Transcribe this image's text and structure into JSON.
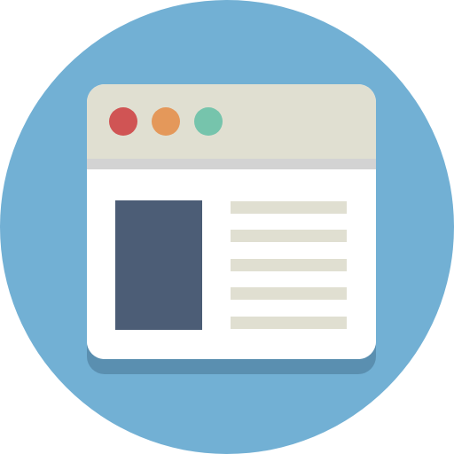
{
  "colors": {
    "background_circle": "#72b0d4",
    "window_shadow": "#5a8fb0",
    "titlebar": "#e0dfd1",
    "titlebar_divider": "#d3d3d3",
    "window_body": "#ffffff",
    "dot_red": "#d05454",
    "dot_orange": "#e4985a",
    "dot_green": "#76c4ac",
    "image_block": "#4c5d76",
    "text_lines": "#e0dfd1"
  },
  "icons": {
    "main": "browser-window-icon",
    "dots": [
      "close-dot",
      "minimize-dot",
      "maximize-dot"
    ]
  },
  "content": {
    "text_line_count": 5
  }
}
